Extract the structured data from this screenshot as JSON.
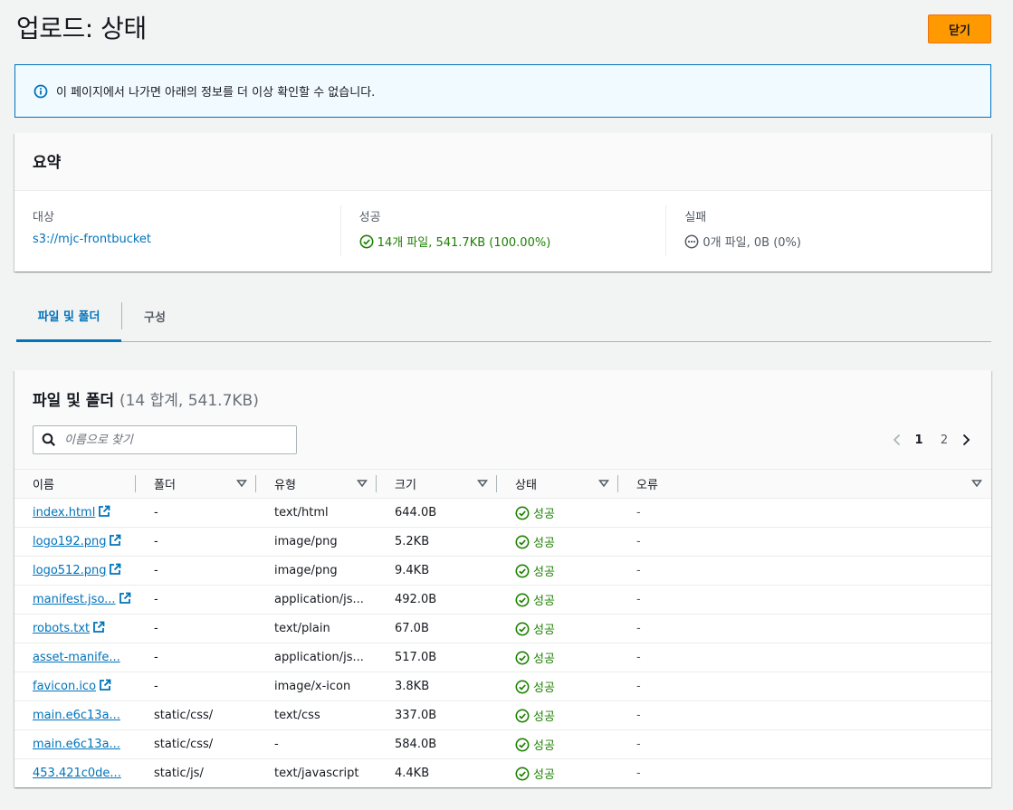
{
  "header": {
    "title": "업로드: 상태",
    "close_label": "닫기"
  },
  "alert": {
    "text": "이 페이지에서 나가면 아래의 정보를 더 이상 확인할 수 없습니다."
  },
  "summary": {
    "title": "요약",
    "destination_label": "대상",
    "destination_value": "s3://mjc-frontbucket",
    "success_label": "성공",
    "success_value": "14개 파일, 541.7KB (100.00%)",
    "failed_label": "실패",
    "failed_value": "0개 파일, 0B (0%)"
  },
  "tabs": [
    {
      "label": "파일 및 폴더",
      "active": true
    },
    {
      "label": "구성",
      "active": false
    }
  ],
  "files": {
    "title": "파일 및 폴더",
    "count": "(14 합계, 541.7KB)",
    "search_placeholder": "이름으로 찾기",
    "pagination": {
      "current": "1",
      "other": "2"
    },
    "columns": [
      "이름",
      "폴더",
      "유형",
      "크기",
      "상태",
      "오류"
    ],
    "rows": [
      {
        "name": "index.html",
        "folder": "-",
        "type": "text/html",
        "size": "644.0B",
        "status": "성공",
        "error": "-"
      },
      {
        "name": "logo192.png",
        "folder": "-",
        "type": "image/png",
        "size": "5.2KB",
        "status": "성공",
        "error": "-"
      },
      {
        "name": "logo512.png",
        "folder": "-",
        "type": "image/png",
        "size": "9.4KB",
        "status": "성공",
        "error": "-"
      },
      {
        "name": "manifest.jso...",
        "folder": "-",
        "type": "application/js...",
        "size": "492.0B",
        "status": "성공",
        "error": "-"
      },
      {
        "name": "robots.txt",
        "folder": "-",
        "type": "text/plain",
        "size": "67.0B",
        "status": "성공",
        "error": "-"
      },
      {
        "name": "asset-manife...",
        "folder": "-",
        "type": "application/js...",
        "size": "517.0B",
        "status": "성공",
        "error": "-"
      },
      {
        "name": "favicon.ico",
        "folder": "-",
        "type": "image/x-icon",
        "size": "3.8KB",
        "status": "성공",
        "error": "-"
      },
      {
        "name": "main.e6c13a...",
        "folder": "static/css/",
        "type": "text/css",
        "size": "337.0B",
        "status": "성공",
        "error": "-"
      },
      {
        "name": "main.e6c13a...",
        "folder": "static/css/",
        "type": "-",
        "size": "584.0B",
        "status": "성공",
        "error": "-"
      },
      {
        "name": "453.421c0de...",
        "folder": "static/js/",
        "type": "text/javascript",
        "size": "4.4KB",
        "status": "성공",
        "error": "-"
      }
    ]
  },
  "colors": {
    "accent": "#0073bb",
    "primary_button": "#ff9900",
    "success": "#1d8102",
    "alert_bg": "#f1faff"
  },
  "icons": [
    "info-icon",
    "success-check-icon",
    "pending-dots-icon",
    "search-icon",
    "external-link-icon",
    "sort-caret-icon",
    "chevron-left-icon",
    "chevron-right-icon"
  ]
}
